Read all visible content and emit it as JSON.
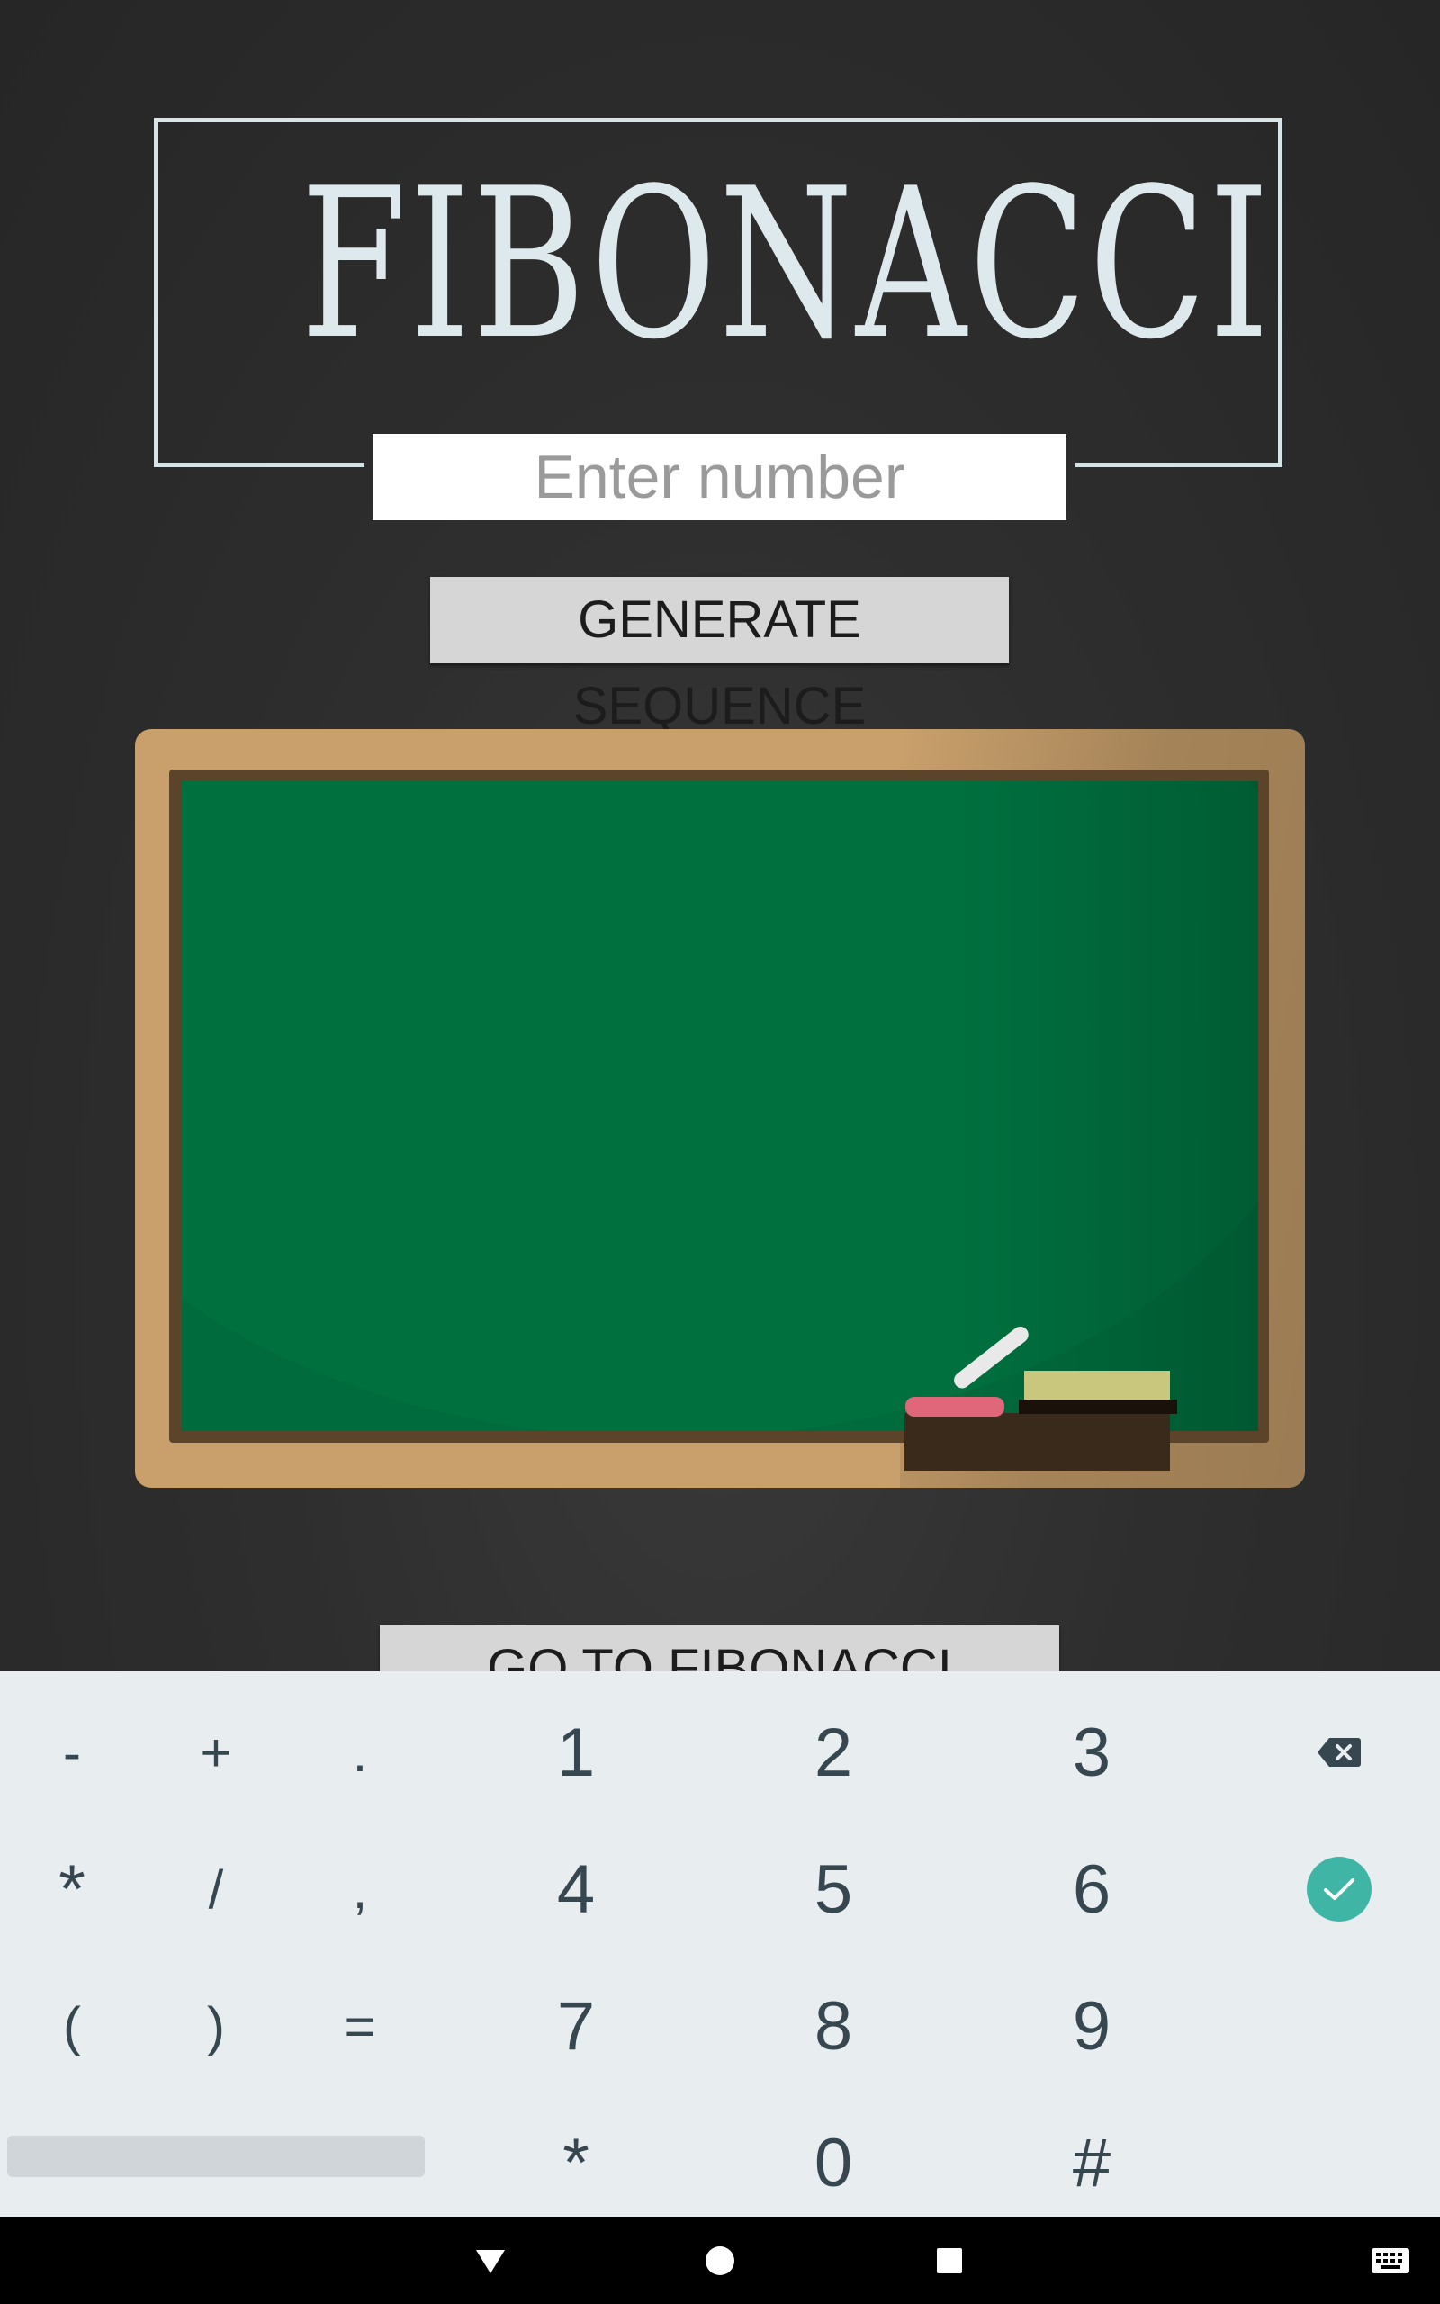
{
  "title": "FIBONACCI",
  "input": {
    "placeholder": "Enter number",
    "value": ""
  },
  "buttons": {
    "generate_label": "GENERATE SEQUENCE",
    "tester_label": "GO TO FIBONACCI TESTER"
  },
  "keyboard": {
    "rows": [
      [
        "-",
        "+",
        ".",
        "1",
        "2",
        "3"
      ],
      [
        "*",
        "/",
        ",",
        "4",
        "5",
        "6"
      ],
      [
        "(",
        ")",
        "=",
        "7",
        "8",
        "9"
      ],
      [
        "*",
        "0",
        "#"
      ]
    ],
    "icons": {
      "backspace": "backspace-icon",
      "done": "check-icon"
    },
    "colors": {
      "background": "#e8edf0",
      "key_text": "#37474f",
      "done_accent": "#3fb5a5"
    }
  },
  "navigation": {
    "icons": [
      "back-icon",
      "home-icon",
      "recents-icon",
      "keyboard-switch-icon"
    ]
  },
  "colors": {
    "app_background": "#2e2e2e",
    "title_color": "#dde9ec",
    "button_background": "#d6d6d6",
    "chalkboard_green": "#006b3c",
    "chalkboard_frame": "#c9a06c"
  }
}
